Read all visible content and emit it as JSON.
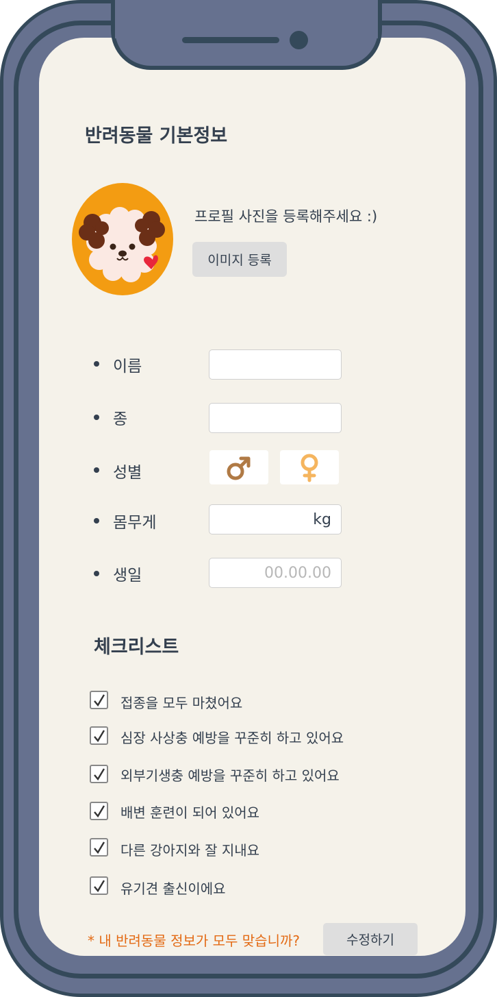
{
  "section_title": "반려동물 기본정보",
  "profile": {
    "prompt": "프로필 사진을 등록해주세요 :)",
    "register_button": "이미지 등록",
    "avatar_icon": "puppy-avatar-icon",
    "avatar_bg_color": "#f39c12"
  },
  "fields": {
    "name_label": "이름",
    "name_value": "",
    "species_label": "종",
    "species_value": "",
    "gender_label": "성별",
    "gender_male_icon": "male-symbol-icon",
    "gender_female_icon": "female-symbol-icon",
    "weight_label": "몸무게",
    "weight_unit": "kg",
    "birthday_label": "생일",
    "birthday_placeholder": "00.00.00"
  },
  "checklist": {
    "title": "체크리스트",
    "items": [
      {
        "label": "접종을 모두 마쳤어요",
        "checked": true
      },
      {
        "label": "심장 사상충 예방을 꾸준히 하고 있어요",
        "checked": true
      },
      {
        "label": "외부기생충 예방을 꾸준히 하고 있어요",
        "checked": true
      },
      {
        "label": "배변 훈련이 되어 있어요",
        "checked": true
      },
      {
        "label": "다른 강아지와 잘 지내요",
        "checked": true
      },
      {
        "label": "유기견 출신이에요",
        "checked": true
      }
    ]
  },
  "footer": {
    "confirm_text": "* 내 반려동물 정보가 모두  맞습니까?",
    "edit_button": "수정하기"
  },
  "colors": {
    "phone_frame": "#66718f",
    "phone_border": "#34495a",
    "screen_bg": "#f5f2ea",
    "text": "#34404f",
    "accent_orange": "#e36a14",
    "male_color": "#b07a45",
    "female_color": "#f5b55f"
  }
}
